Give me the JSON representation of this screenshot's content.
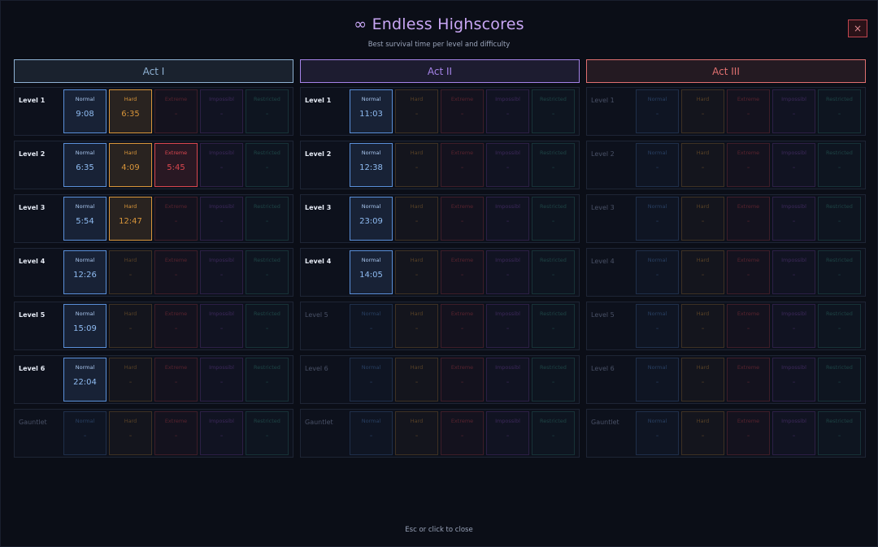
{
  "title": "∞ Endless Highscores",
  "subtitle": "Best survival time per level and difficulty",
  "close_icon": "×",
  "footer": "Esc or click to close",
  "difficulties": [
    {
      "name": "Normal",
      "color": "#5a8fd8"
    },
    {
      "name": "Hard",
      "color": "#d8953a"
    },
    {
      "name": "Extreme",
      "color": "#d8464e"
    },
    {
      "name": "Impossibl",
      "color": "#8d4fc2"
    },
    {
      "name": "Restricted",
      "color": "#3a9a8a"
    }
  ],
  "acts": [
    {
      "name": "Act I",
      "color": "#8fb2d4",
      "rows": [
        {
          "label": "Level 1",
          "unlocked": true,
          "times": [
            "9:08",
            "6:35",
            "-",
            "-",
            "-"
          ]
        },
        {
          "label": "Level 2",
          "unlocked": true,
          "times": [
            "6:35",
            "4:09",
            "5:45",
            "-",
            "-"
          ]
        },
        {
          "label": "Level 3",
          "unlocked": true,
          "times": [
            "5:54",
            "12:47",
            "-",
            "-",
            "-"
          ]
        },
        {
          "label": "Level 4",
          "unlocked": true,
          "times": [
            "12:26",
            "-",
            "-",
            "-",
            "-"
          ]
        },
        {
          "label": "Level 5",
          "unlocked": true,
          "times": [
            "15:09",
            "-",
            "-",
            "-",
            "-"
          ]
        },
        {
          "label": "Level 6",
          "unlocked": true,
          "times": [
            "22:04",
            "-",
            "-",
            "-",
            "-"
          ]
        },
        {
          "label": "Gauntlet",
          "unlocked": false,
          "times": [
            "-",
            "-",
            "-",
            "-",
            "-"
          ]
        }
      ]
    },
    {
      "name": "Act II",
      "color": "#a583e8",
      "rows": [
        {
          "label": "Level 1",
          "unlocked": true,
          "times": [
            "11:03",
            "-",
            "-",
            "-",
            "-"
          ]
        },
        {
          "label": "Level 2",
          "unlocked": true,
          "times": [
            "12:38",
            "-",
            "-",
            "-",
            "-"
          ]
        },
        {
          "label": "Level 3",
          "unlocked": true,
          "times": [
            "23:09",
            "-",
            "-",
            "-",
            "-"
          ]
        },
        {
          "label": "Level 4",
          "unlocked": true,
          "times": [
            "14:05",
            "-",
            "-",
            "-",
            "-"
          ]
        },
        {
          "label": "Level 5",
          "unlocked": false,
          "times": [
            "-",
            "-",
            "-",
            "-",
            "-"
          ]
        },
        {
          "label": "Level 6",
          "unlocked": false,
          "times": [
            "-",
            "-",
            "-",
            "-",
            "-"
          ]
        },
        {
          "label": "Gauntlet",
          "unlocked": false,
          "times": [
            "-",
            "-",
            "-",
            "-",
            "-"
          ]
        }
      ]
    },
    {
      "name": "Act III",
      "color": "#e07070",
      "rows": [
        {
          "label": "Level 1",
          "unlocked": false,
          "times": [
            "-",
            "-",
            "-",
            "-",
            "-"
          ]
        },
        {
          "label": "Level 2",
          "unlocked": false,
          "times": [
            "-",
            "-",
            "-",
            "-",
            "-"
          ]
        },
        {
          "label": "Level 3",
          "unlocked": false,
          "times": [
            "-",
            "-",
            "-",
            "-",
            "-"
          ]
        },
        {
          "label": "Level 4",
          "unlocked": false,
          "times": [
            "-",
            "-",
            "-",
            "-",
            "-"
          ]
        },
        {
          "label": "Level 5",
          "unlocked": false,
          "times": [
            "-",
            "-",
            "-",
            "-",
            "-"
          ]
        },
        {
          "label": "Level 6",
          "unlocked": false,
          "times": [
            "-",
            "-",
            "-",
            "-",
            "-"
          ]
        },
        {
          "label": "Gauntlet",
          "unlocked": false,
          "times": [
            "-",
            "-",
            "-",
            "-",
            "-"
          ]
        }
      ]
    }
  ]
}
